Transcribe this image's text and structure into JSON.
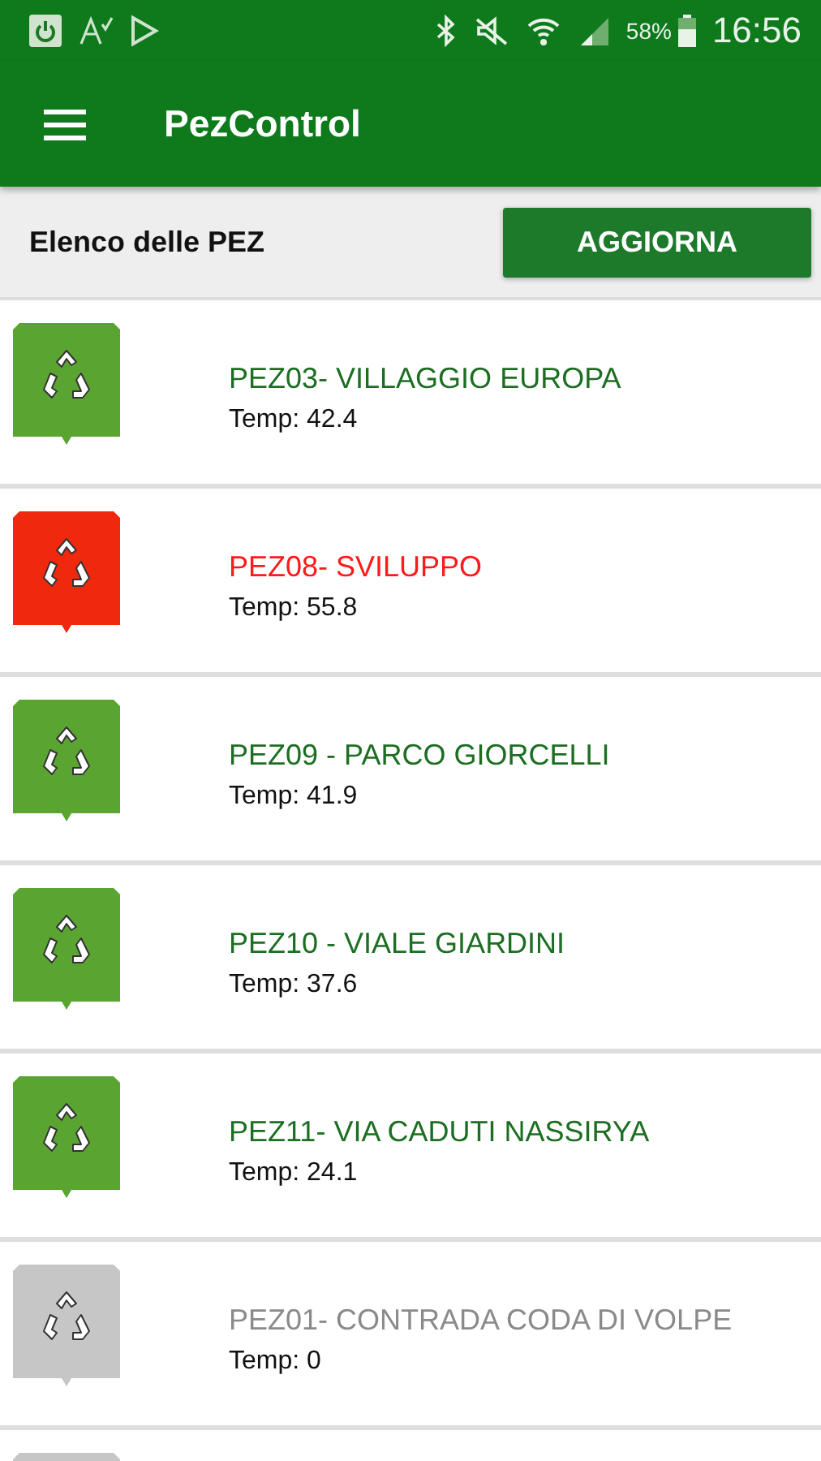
{
  "status_bar": {
    "battery": "58%",
    "time": "16:56"
  },
  "app_bar": {
    "title": "PezControl"
  },
  "header": {
    "title": "Elenco delle PEZ",
    "button": "AGGIORNA"
  },
  "items": [
    {
      "color": "#5aa532",
      "name": "PEZ03- VILLAGGIO EUROPA",
      "temp": "Temp: 42.4"
    },
    {
      "color": "#f0290e",
      "name": "PEZ08- SVILUPPO",
      "temp": "Temp: 55.8"
    },
    {
      "color": "#5aa532",
      "name": "PEZ09 - PARCO GIORCELLI",
      "temp": "Temp: 41.9"
    },
    {
      "color": "#5aa532",
      "name": "PEZ10 - VIALE GIARDINI",
      "temp": "Temp: 37.6"
    },
    {
      "color": "#5aa532",
      "name": "PEZ11- VIA CADUTI NASSIRYA",
      "temp": "Temp: 24.1"
    },
    {
      "color": "#c6c6c6",
      "name": "PEZ01- CONTRADA CODA DI VOLPE",
      "temp": "Temp: 0"
    },
    {
      "color": "#c6c6c6"
    }
  ]
}
